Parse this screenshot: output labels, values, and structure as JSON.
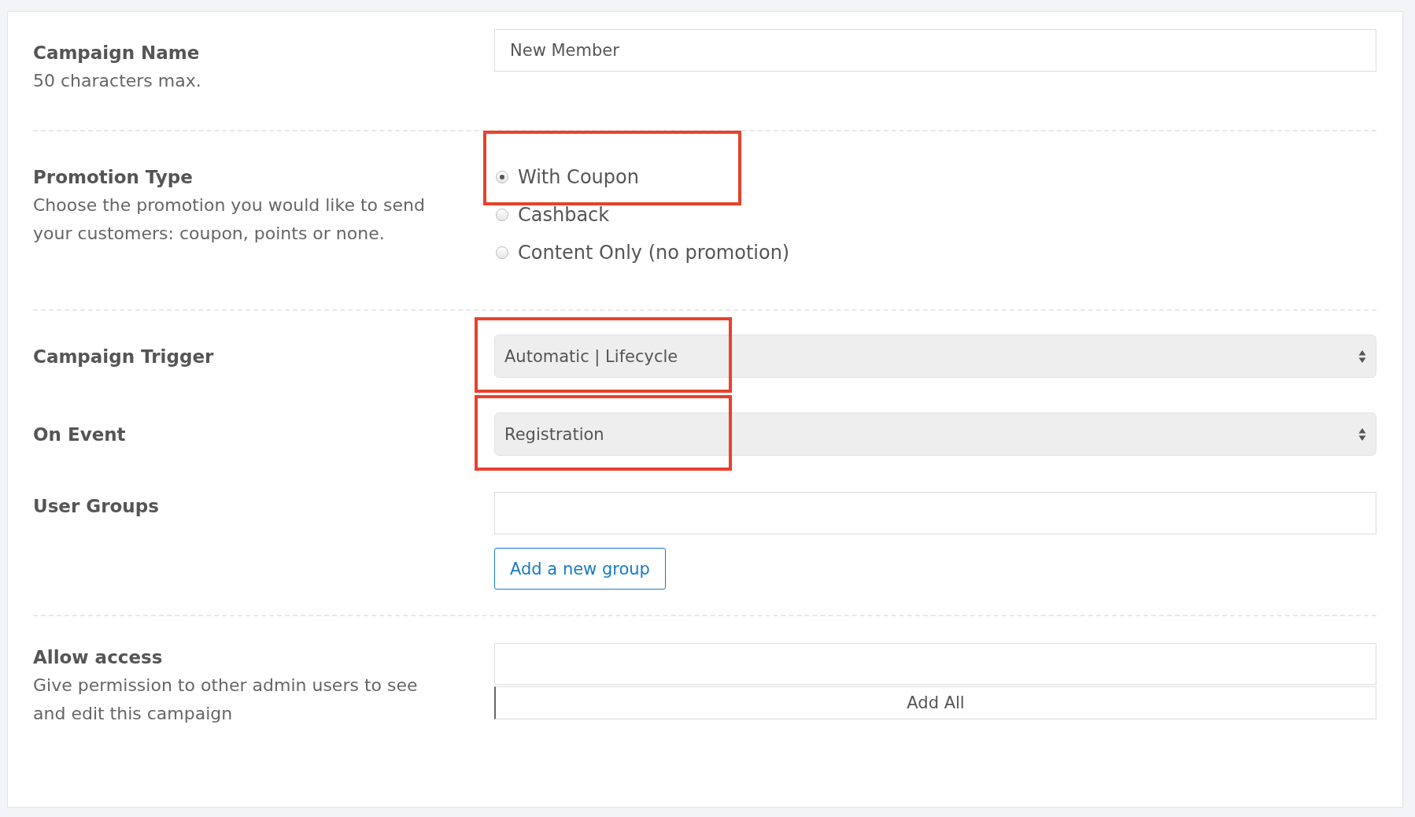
{
  "campaign_name": {
    "label": "Campaign Name",
    "hint": "50 characters max.",
    "value": "New Member"
  },
  "promotion_type": {
    "label": "Promotion Type",
    "hint": "Choose the promotion you would like to send your customers: coupon, points or none.",
    "options": [
      {
        "label": "With Coupon",
        "selected": true,
        "highlighted": true
      },
      {
        "label": "Cashback",
        "selected": false,
        "highlighted": false
      },
      {
        "label": "Content Only (no promotion)",
        "selected": false,
        "highlighted": false
      }
    ]
  },
  "campaign_trigger": {
    "label": "Campaign Trigger",
    "value": "Automatic | Lifecycle",
    "highlighted": true
  },
  "on_event": {
    "label": "On Event",
    "value": "Registration",
    "highlighted": true
  },
  "user_groups": {
    "label": "User Groups",
    "button": "Add a new group"
  },
  "allow_access": {
    "label": "Allow access",
    "hint": "Give permission to other admin users to see and edit this campaign",
    "button": "Add All"
  }
}
